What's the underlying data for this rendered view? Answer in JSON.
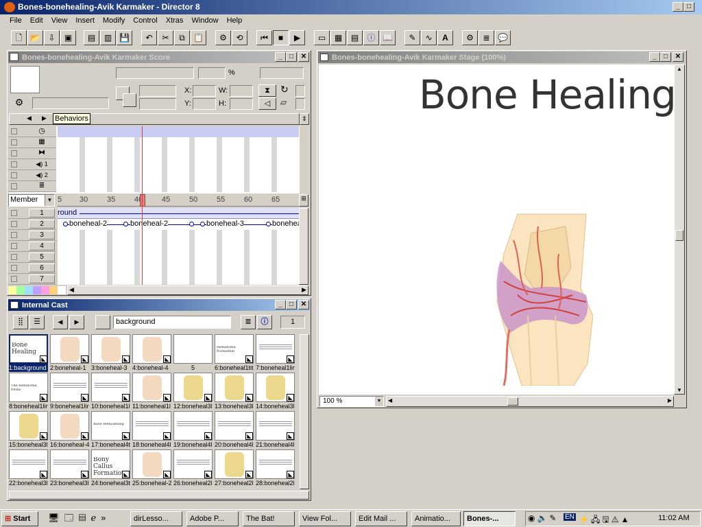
{
  "app": {
    "title": "Bones-bonehealing-Avik Karmaker - Director 8",
    "menu": [
      "File",
      "Edit",
      "View",
      "Insert",
      "Modify",
      "Control",
      "Xtras",
      "Window",
      "Help"
    ]
  },
  "score": {
    "title": "Bones-bonehealing-Avik Karmaker Score",
    "tooltip": "Behaviors",
    "member_select": "Member",
    "frame_numbers": [
      "5",
      "30",
      "35",
      "40",
      "45",
      "50",
      "55",
      "60",
      "65"
    ],
    "channels": [
      "1",
      "2",
      "3",
      "4",
      "5",
      "6",
      "7"
    ],
    "channel1_sprite": "round",
    "channel2_sprites": [
      "boneheal-2",
      "boneheal-2",
      "boneheal-3",
      "bonehea"
    ],
    "labels": {
      "x": "X:",
      "y": "Y:",
      "w": "W:",
      "h": "H:",
      "pct": "%"
    }
  },
  "cast": {
    "title": "Internal Cast",
    "member_name": "background",
    "member_number": "1",
    "members": [
      {
        "label": "1:background",
        "thumb": "Bone Healing",
        "sel": true
      },
      {
        "label": "2:boneheal-1",
        "thumb": "bone"
      },
      {
        "label": "3:boneheal-3",
        "thumb": "bone"
      },
      {
        "label": "4:boneheal-4",
        "thumb": "bone"
      },
      {
        "label": "5",
        "thumb": ""
      },
      {
        "label": "6:boneheal1tit",
        "thumb": "Hematoma Formation"
      },
      {
        "label": "7:boneheal1lin",
        "thumb": "text"
      },
      {
        "label": "8:boneheal1lin",
        "thumb": "The hematoma forms"
      },
      {
        "label": "9:boneheal1lin",
        "thumb": "text"
      },
      {
        "label": "10:boneheal1l",
        "thumb": "text"
      },
      {
        "label": "11:boneheal1l",
        "thumb": "bone"
      },
      {
        "label": "12:boneheal3l",
        "thumb": "fiber"
      },
      {
        "label": "13:boneheal3l",
        "thumb": "fiber"
      },
      {
        "label": "14:boneheal3l",
        "thumb": "fiber"
      },
      {
        "label": "15:boneheal3l",
        "thumb": "fiber"
      },
      {
        "label": "16:boneheal-4",
        "thumb": "bone"
      },
      {
        "label": "17:boneheal4t",
        "thumb": "Bone Remodeling"
      },
      {
        "label": "18:boneheal4l",
        "thumb": "text"
      },
      {
        "label": "19:boneheal4l",
        "thumb": "text"
      },
      {
        "label": "20:boneheal4l",
        "thumb": "text"
      },
      {
        "label": "21:boneheal4l",
        "thumb": "text"
      },
      {
        "label": "22:boneheal3l",
        "thumb": "text"
      },
      {
        "label": "23:boneheal3l",
        "thumb": "text"
      },
      {
        "label": "24:boneheal3t",
        "thumb": "Bony Callus Formation"
      },
      {
        "label": "25:boneheal-2",
        "thumb": "bone"
      },
      {
        "label": "26:boneheal2l",
        "thumb": "text"
      },
      {
        "label": "27:boneheal2l",
        "thumb": "fiber"
      },
      {
        "label": "28:boneheal2l",
        "thumb": "text"
      }
    ]
  },
  "stage": {
    "title": "Bones-bonehealing-Avik Karmaker Stage (100%)",
    "heading": "Bone Healing",
    "zoom": "100 %"
  },
  "taskbar": {
    "start": "Start",
    "tasks": [
      "dirLesso...",
      "Adobe P...",
      "The Bat!",
      "View Fol...",
      "Edit Mail ...",
      "Animatio...",
      "Bones-..."
    ],
    "tray_lang": "EN",
    "clock": "11:02 AM"
  },
  "colors": {
    "title_active": "#0a246a",
    "playhead": "#d04040",
    "sprite_line": "#0000a0"
  }
}
